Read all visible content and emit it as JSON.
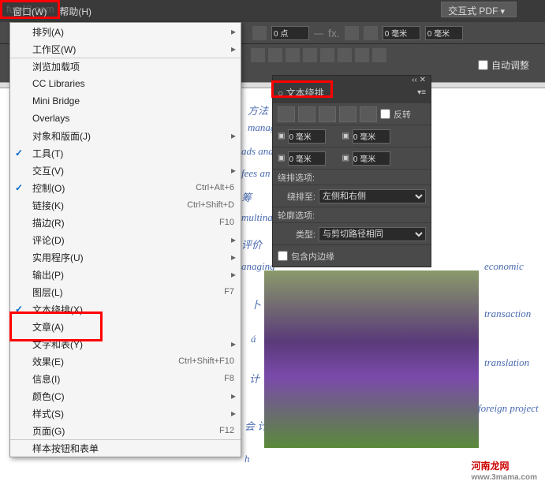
{
  "menubar": {
    "window": "窗口(W)",
    "help": "帮助(H)"
  },
  "pdf_button": "交互式 PDF",
  "watermark_top": "fun48.com",
  "toolbar1": {
    "val1": "0 点",
    "val2": "0 毫米",
    "val3": "0 毫米"
  },
  "auto_fit": "自动调整",
  "dropdown": {
    "items": [
      {
        "label": "排列(A)",
        "sub": true
      },
      {
        "label": "工作区(W)",
        "sub": true
      },
      {
        "label": "浏览加载项",
        "sep": true
      },
      {
        "label": "CC Libraries"
      },
      {
        "label": "Mini Bridge"
      },
      {
        "label": "Overlays"
      },
      {
        "label": "对象和版面(J)",
        "sub": true
      },
      {
        "label": "工具(T)",
        "checked": true
      },
      {
        "label": "交互(V)",
        "sub": true
      },
      {
        "label": "控制(O)",
        "checked": true,
        "shortcut": "Ctrl+Alt+6"
      },
      {
        "label": "链接(K)",
        "shortcut": "Ctrl+Shift+D"
      },
      {
        "label": "描边(R)",
        "shortcut": "F10"
      },
      {
        "label": "评论(D)",
        "sub": true
      },
      {
        "label": "实用程序(U)",
        "sub": true
      },
      {
        "label": "输出(P)",
        "sub": true
      },
      {
        "label": "图层(L)",
        "shortcut": "F7"
      },
      {
        "label": "文本绕排(X)",
        "checked": true
      },
      {
        "label": "文章(A)"
      },
      {
        "label": "文字和表(Y)",
        "sub": true
      },
      {
        "label": "效果(E)",
        "shortcut": "Ctrl+Shift+F10"
      },
      {
        "label": "信息(I)",
        "shortcut": "F8"
      },
      {
        "label": "颜色(C)",
        "sub": true
      },
      {
        "label": "样式(S)",
        "sub": true
      },
      {
        "label": "页面(G)",
        "shortcut": "F12"
      },
      {
        "label": "样本按钮和表单",
        "sep": true
      }
    ]
  },
  "panel": {
    "title": "○ 文本绕排",
    "invert": "反转",
    "offset1": "0 毫米",
    "offset2": "0 毫米",
    "offset3": "0 毫米",
    "offset4": "0 毫米",
    "wrap_options": "绕排选项:",
    "wrap_to": "绕排至:",
    "wrap_to_val": "左侧和右侧",
    "contour_options": "轮廓选项:",
    "type_label": "类型:",
    "type_val": "与剪切路径相同",
    "include_inside": "包含内边缘"
  },
  "doc_texts": [
    "方法",
    "manage",
    "ads and",
    "fees an",
    "筹",
    "multina",
    "评价",
    "anaging",
    "卜",
    "á",
    "计",
    "会 计",
    "h",
    "economic",
    "transaction",
    "translation",
    "foreign project"
  ],
  "footer": {
    "brand": "河南龙网",
    "url": "www.3mama.com"
  }
}
